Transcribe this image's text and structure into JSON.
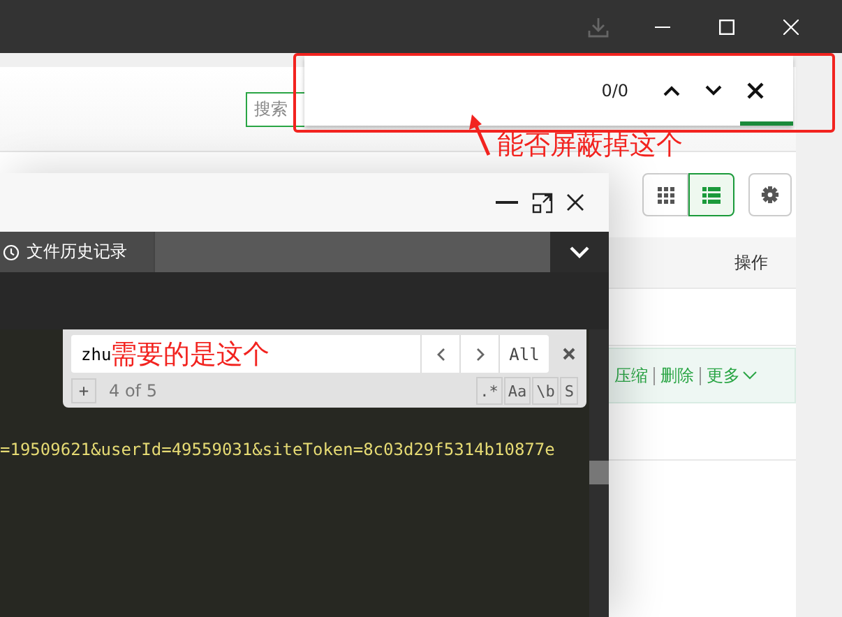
{
  "window": {
    "download_disabled": true
  },
  "page": {
    "search": {
      "placeholder": "搜索"
    },
    "view_buttons": [
      {
        "kind": "grid",
        "selected": false
      },
      {
        "kind": "list",
        "selected": true
      }
    ],
    "table": {
      "columns": [
        {
          "label": "操作"
        }
      ],
      "row_actions": [
        {
          "label": "压缩",
          "dropdown": false
        },
        {
          "label": "删除",
          "dropdown": false
        },
        {
          "label": "更多",
          "dropdown": true
        }
      ]
    }
  },
  "find_bar": {
    "count": "0/0"
  },
  "dialog": {
    "tabs": [
      {
        "label": "文件历史记录",
        "selected": false
      }
    ],
    "search": {
      "value": "zhu",
      "all": "All",
      "add": "+",
      "count": "4 of 5",
      "options": [
        {
          "label": ".*",
          "on": false
        },
        {
          "label": "Aa",
          "on": false
        },
        {
          "label": "\\b",
          "on": false
        },
        {
          "label": "S",
          "on": false
        }
      ]
    },
    "code_line": "=19509621&userId=49559031&siteToken=8c03d29f5314b10877e"
  },
  "annotations": [
    {
      "text": "能否屏蔽掉这个"
    },
    {
      "text": "需要的是这个"
    }
  ]
}
